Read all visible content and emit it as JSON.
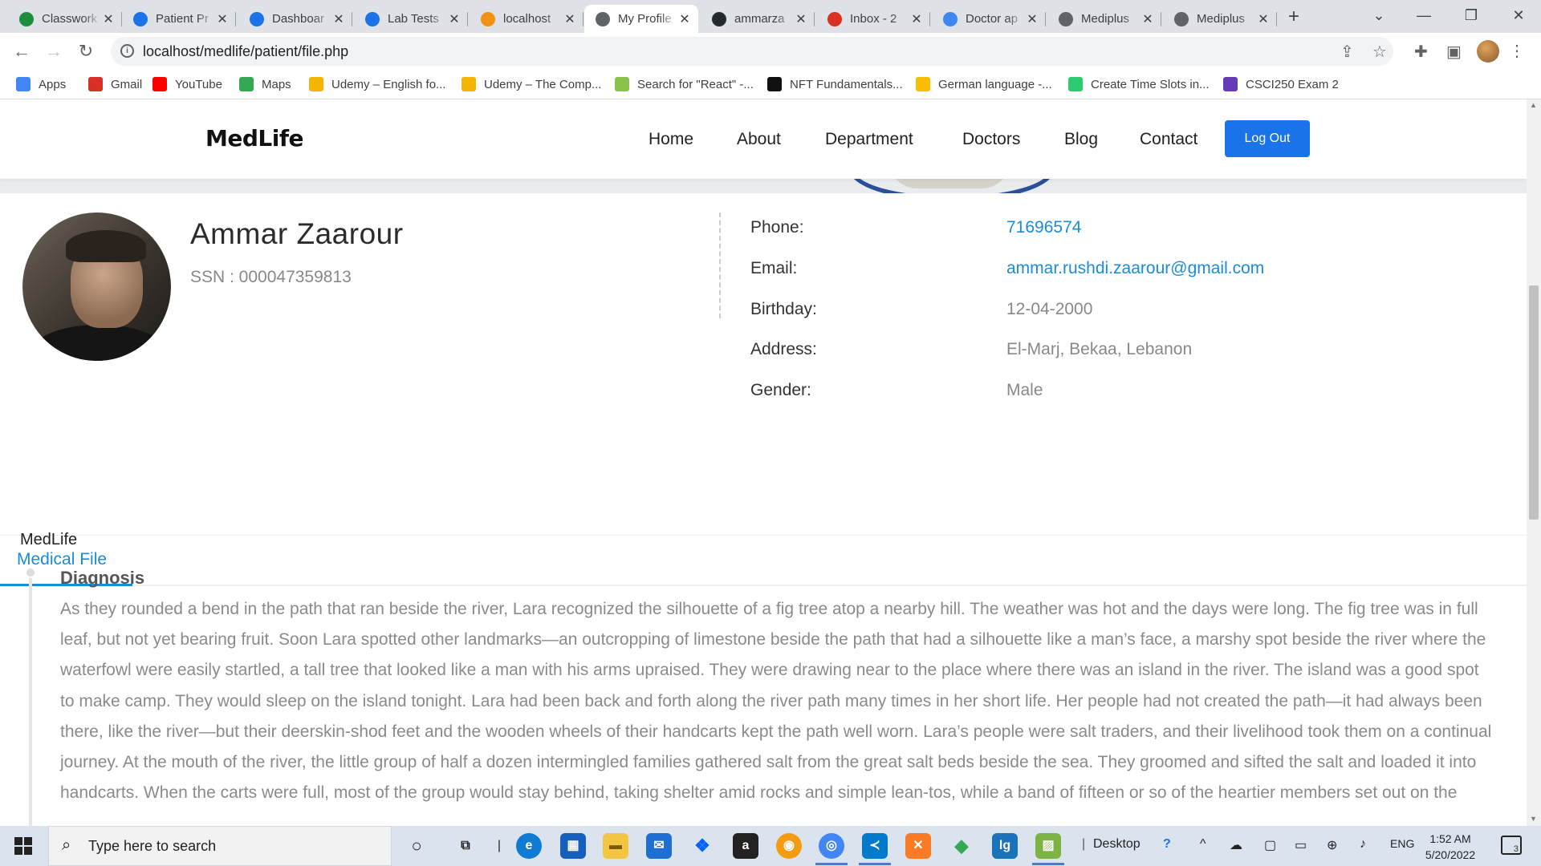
{
  "browser": {
    "tabs": [
      {
        "title": "Classwork",
        "icon": "classroom-icon",
        "color": "#1e8e3e"
      },
      {
        "title": "Patient Pr",
        "icon": "medical-cross-icon",
        "color": "#1a73e8"
      },
      {
        "title": "Dashboar",
        "icon": "medical-cross-icon",
        "color": "#1a73e8"
      },
      {
        "title": "Lab Tests",
        "icon": "medical-cross-icon",
        "color": "#1a73e8"
      },
      {
        "title": "localhost",
        "icon": "phpmyadmin-icon",
        "color": "#f29111"
      },
      {
        "title": "My Profile",
        "icon": "globe-icon",
        "color": "#5f6368",
        "active": true
      },
      {
        "title": "ammarza",
        "icon": "github-icon",
        "color": "#24292e"
      },
      {
        "title": "Inbox - 2",
        "icon": "gmail-icon",
        "color": "#d93025"
      },
      {
        "title": "Doctor ap",
        "icon": "google-icon",
        "color": "#4285f4"
      },
      {
        "title": "Mediplus",
        "icon": "globe-icon",
        "color": "#5f6368"
      },
      {
        "title": "Mediplus",
        "icon": "globe-icon",
        "color": "#5f6368"
      }
    ],
    "url": "localhost/medlife/patient/file.php",
    "bookmarks": [
      {
        "label": "Apps",
        "icon": "apps-grid-icon",
        "color": "#4285f4"
      },
      {
        "label": "Gmail",
        "icon": "gmail-icon",
        "color": "#d93025"
      },
      {
        "label": "YouTube",
        "icon": "youtube-icon",
        "color": "#ff0000"
      },
      {
        "label": "Maps",
        "icon": "maps-icon",
        "color": "#34a853"
      },
      {
        "label": "Udemy – English fo...",
        "icon": "udemy-icon",
        "color": "#f4b400"
      },
      {
        "label": "Udemy – The Comp...",
        "icon": "udemy-icon",
        "color": "#f4b400"
      },
      {
        "label": "Search for \"React\" -...",
        "icon": "upwork-icon",
        "color": "#8bc34a"
      },
      {
        "label": "NFT Fundamentals...",
        "icon": "sk-icon",
        "color": "#111111"
      },
      {
        "label": "German language -...",
        "icon": "drive-icon",
        "color": "#fbbc04"
      },
      {
        "label": "Create Time Slots in...",
        "icon": "green-circle-icon",
        "color": "#2ecc71"
      },
      {
        "label": "CSCI250 Exam 2",
        "icon": "form-icon",
        "color": "#673ab7"
      }
    ]
  },
  "site": {
    "logo": "MedLife",
    "nav": [
      "Home",
      "About",
      "Department",
      "Doctors",
      "Blog",
      "Contact"
    ],
    "logout_label": "Log Out"
  },
  "profile": {
    "name": "Ammar Zaarour",
    "ssn": "SSN : 000047359813",
    "fields": [
      {
        "label": "Phone:",
        "value": "71696574",
        "link": true
      },
      {
        "label": "Email:",
        "value": "ammar.rushdi.zaarour@gmail.com",
        "link": true
      },
      {
        "label": "Birthday:",
        "value": "12-04-2000",
        "link": false
      },
      {
        "label": "Address:",
        "value": "El-Marj, Bekaa, Lebanon",
        "link": false
      },
      {
        "label": "Gender:",
        "value": "Male",
        "link": false
      }
    ]
  },
  "tabs": {
    "medical_file": "Medical File"
  },
  "medical_file": {
    "source": "MedLife",
    "entry_title": "Diagnosis",
    "entry_text": "As they rounded a bend in the path that ran beside the river, Lara recognized the silhouette of a fig tree atop a nearby hill. The weather was hot and the days were long. The fig tree was in full leaf, but not yet bearing fruit. Soon Lara spotted other landmarks—an outcropping of limestone beside the path that had a silhouette like a man’s face, a marshy spot beside the river where the waterfowl were easily startled, a tall tree that looked like a man with his arms upraised. They were drawing near to the place where there was an island in the river. The island was a good spot to make camp. They would sleep on the island tonight. Lara had been back and forth along the river path many times in her short life. Her people had not created the path—it had always been there, like the river—but their deerskin-shod feet and the wooden wheels of their handcarts kept the path well worn. Lara’s people were salt traders, and their livelihood took them on a continual journey. At the mouth of the river, the little group of half a dozen intermingled families gathered salt from the great salt beds beside the sea. They groomed and sifted the salt and loaded it into handcarts. When the carts were full, most of the group would stay behind, taking shelter amid rocks and simple lean-tos, while a band of fifteen or so of the heartier members set out on the"
  },
  "taskbar": {
    "search_placeholder": "Type here to search",
    "desktop_label": "Desktop",
    "lang": "ENG",
    "time": "1:52 AM",
    "date": "5/20/2022",
    "notification_count": "3"
  }
}
